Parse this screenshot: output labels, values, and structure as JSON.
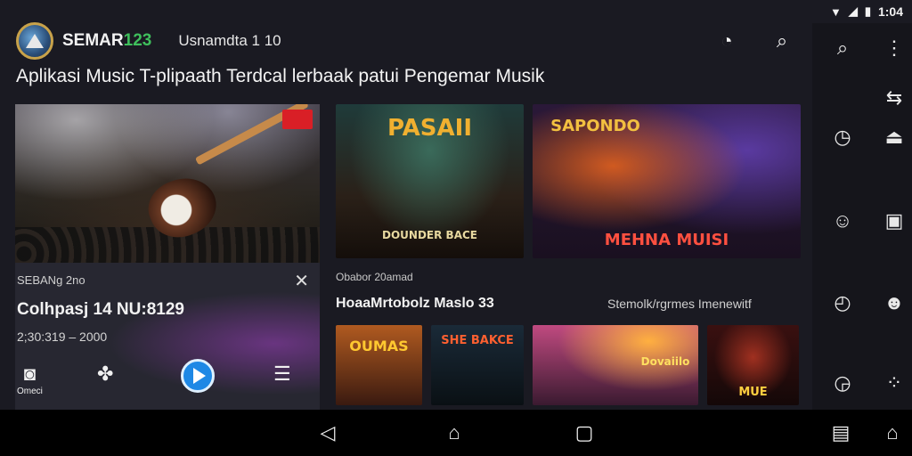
{
  "status": {
    "time": "1:04",
    "icons": [
      "wifi-icon",
      "signal-icon",
      "battery-icon"
    ]
  },
  "header": {
    "brand_main": "SEMAR",
    "brand_accent": "123",
    "subtitle": "Usnamdta 1 10"
  },
  "headline": "Aplikasi Music T-plipaath Terdcal lerbaak patui Pengemar Musik",
  "now_playing": {
    "small_label": "SEBANg 2no",
    "title": "Colhpasj 14 NU:8129",
    "time": "2;30:319 – 2000",
    "controls": [
      {
        "icon": "camera-icon",
        "label": "Omeci"
      },
      {
        "icon": "puzzle-icon",
        "label": ""
      },
      {
        "icon": "play-icon",
        "label": ""
      },
      {
        "icon": "list-icon",
        "label": ""
      }
    ]
  },
  "featured": [
    {
      "title": "PASAII",
      "caption": "DOUNDER BACE"
    },
    {
      "title": "SAPONDO",
      "caption": "MEHNA MUISI"
    }
  ],
  "section": {
    "label": "Obabor 20amad",
    "title": "HoaaMrtobolz Maslo 33",
    "subtitle": "Stemolk/rgrmes Imenewitf"
  },
  "albums": [
    {
      "title": "OUMAS"
    },
    {
      "title": "SHE BAKCE"
    },
    {
      "title": "Dovaiilo"
    },
    {
      "title": "MUE"
    }
  ],
  "colors": {
    "accent": "#3fbf5c",
    "play": "#1e88e5",
    "badge": "#d91f26",
    "background": "#1a1a22"
  }
}
